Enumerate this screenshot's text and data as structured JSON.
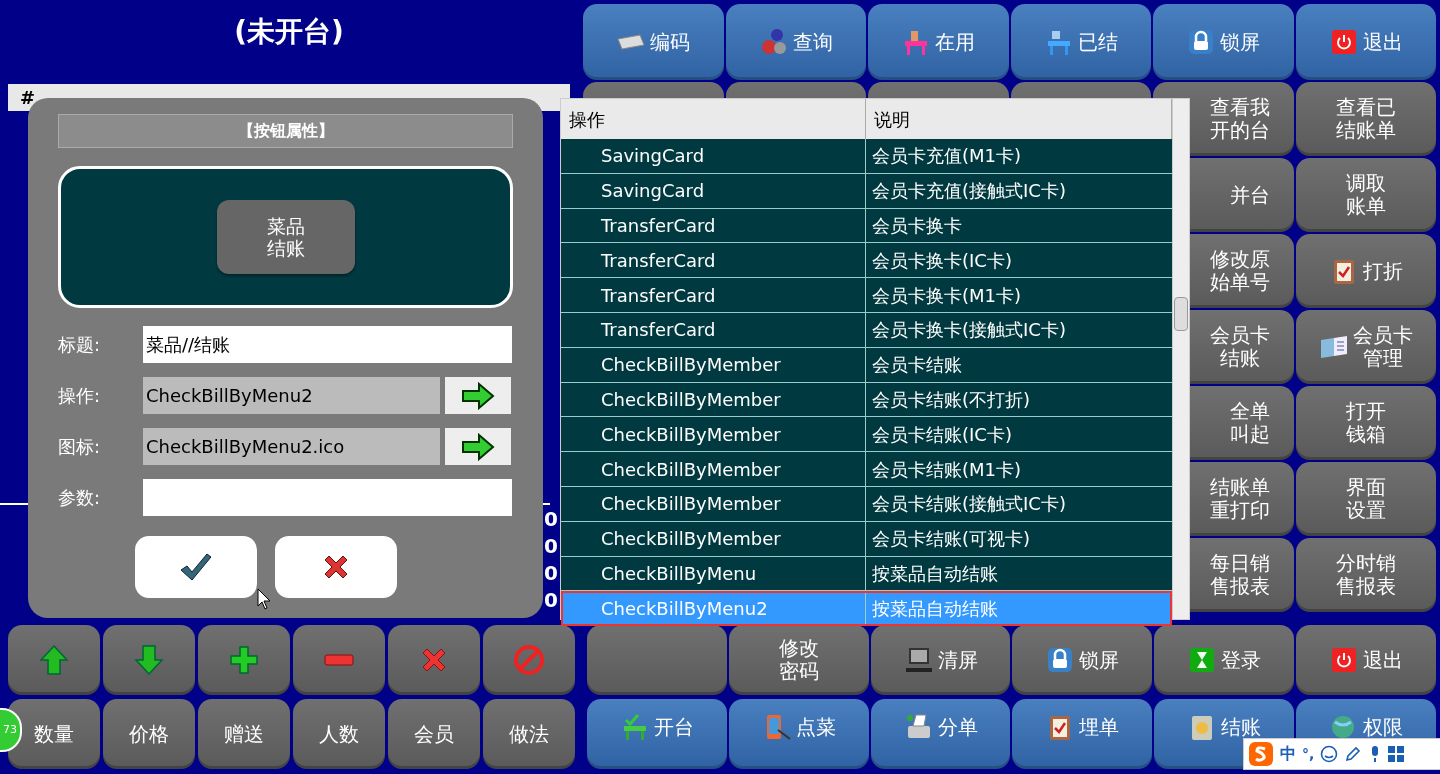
{
  "title": "(未开台)",
  "order_table": {
    "columns": [
      "#"
    ],
    "amounts": [
      "0",
      "0",
      "0",
      "0"
    ]
  },
  "top_buttons": [
    "编码",
    "查询",
    "在用",
    "已结",
    "锁屏",
    "退出"
  ],
  "side_buttons": [
    [
      "查看我开的台",
      "查看已结账单"
    ],
    [
      "并台",
      "调取账单"
    ],
    [
      "修改原始单号",
      "打折"
    ],
    [
      "会员卡结账",
      "会员卡管理"
    ],
    [
      "全单叫起",
      "打开钱箱"
    ],
    [
      "结账单重打印",
      "界面设置"
    ],
    [
      "每日销售报表",
      "分时销售报表"
    ]
  ],
  "lower_buttons": [
    "修改密码",
    "清屏",
    "锁屏",
    "登录",
    "退出"
  ],
  "bottom_left_buttons": [
    "数量",
    "价格",
    "赠送",
    "人数",
    "会员",
    "做法"
  ],
  "bottom_right_buttons": [
    "开台",
    "点菜",
    "分单",
    "埋单",
    "结账",
    "权限"
  ],
  "badge": "73",
  "dialog": {
    "title": "【按钮属性】",
    "preview_button": "菜品结账",
    "fields": [
      {
        "label": "标题:",
        "kind": "text",
        "value": "菜品//结账"
      },
      {
        "label": "操作:",
        "kind": "picker",
        "value": "CheckBillByMenu2"
      },
      {
        "label": "图标:",
        "kind": "picker",
        "value": "CheckBillByMenu2.ico"
      },
      {
        "label": "参数:",
        "kind": "text"
      }
    ]
  },
  "action_list": {
    "columns": [
      "操作",
      "说明"
    ],
    "rows": [
      {
        "operation": "SavingCard",
        "description": "会员卡充值(M1卡)",
        "selected": false
      },
      {
        "operation": "SavingCard",
        "description": "会员卡充值(接触式IC卡)",
        "selected": false
      },
      {
        "operation": "TransferCard",
        "description": "会员卡换卡",
        "selected": false
      },
      {
        "operation": "TransferCard",
        "description": "会员卡换卡(IC卡)",
        "selected": false
      },
      {
        "operation": "TransferCard",
        "description": "会员卡换卡(M1卡)",
        "selected": false
      },
      {
        "operation": "TransferCard",
        "description": "会员卡换卡(接触式IC卡)",
        "selected": false
      },
      {
        "operation": "CheckBillByMember",
        "description": "会员卡结账",
        "selected": false
      },
      {
        "operation": "CheckBillByMember",
        "description": "会员卡结账(不打折)",
        "selected": false
      },
      {
        "operation": "CheckBillByMember",
        "description": "会员卡结账(IC卡)",
        "selected": false
      },
      {
        "operation": "CheckBillByMember",
        "description": "会员卡结账(M1卡)",
        "selected": false
      },
      {
        "operation": "CheckBillByMember",
        "description": "会员卡结账(接触式IC卡)",
        "selected": false
      },
      {
        "operation": "CheckBillByMember",
        "description": "会员卡结账(可视卡)",
        "selected": false
      },
      {
        "operation": "CheckBillByMenu",
        "description": "按菜品自动结账",
        "selected": false
      },
      {
        "operation": "CheckBillByMenu2",
        "description": "按菜品自动结账",
        "selected": true
      }
    ]
  },
  "ime_bar": {
    "mode": "中",
    "punctuation": "°,"
  }
}
